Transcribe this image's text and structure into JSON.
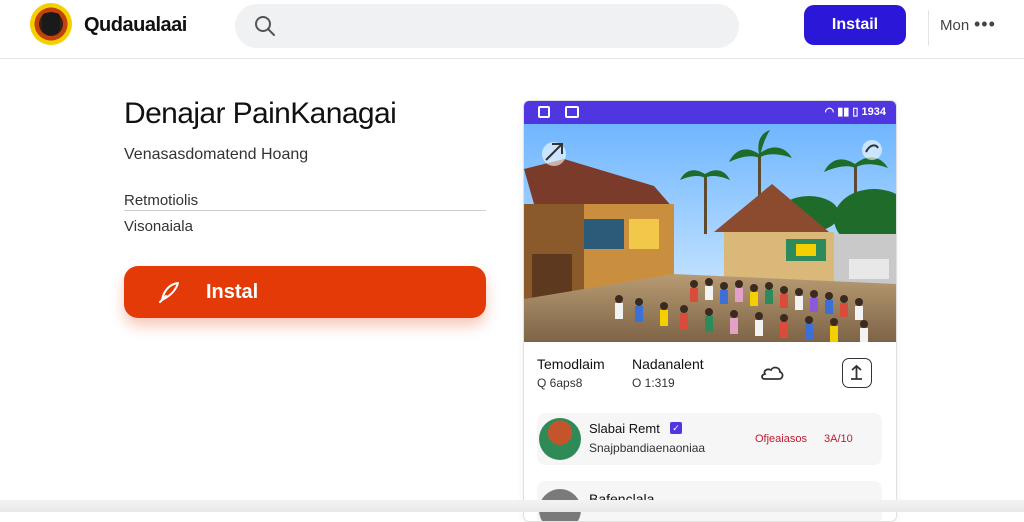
{
  "header": {
    "brand": "Qudaualaai",
    "install_label": "Instail",
    "more_label": "Mon",
    "dots": "•••",
    "icons": [
      "logo-emblem",
      "search-icon",
      "more-dots-icon"
    ]
  },
  "main": {
    "title": "Denajar PainKanagai",
    "subtitle": "Venasasdomatend Hoang",
    "field_label": "Retmotiolis",
    "field_value": "Visonaiala",
    "install_label": "Instal",
    "install_icon": "feather-icon"
  },
  "card": {
    "status_time": "1934",
    "status_icons": [
      "square-icon",
      "grid-icon",
      "wifi-icon",
      "signal-icon",
      "battery-icon"
    ],
    "col1_title": "Temodlaim",
    "col1_sub": "Q 6aps8",
    "col2_title": "Nadanalent",
    "col2_sub": "O 1:319",
    "cloud_icon": "cloud-icon",
    "share_icon": "share-icon",
    "row1": {
      "title": "Slabai Remt",
      "sub": "Snajpbandiaenaoniaa",
      "tag1": "Ofjeaiasos",
      "tag2": "3A/10",
      "verified": "✓"
    },
    "row2": {
      "title": "Bafenclala"
    }
  },
  "colors": {
    "header_button": "#2a17d8",
    "cta": "#e33a07",
    "status_bar": "#4f36e0",
    "accent_red": "#c01b2e"
  }
}
